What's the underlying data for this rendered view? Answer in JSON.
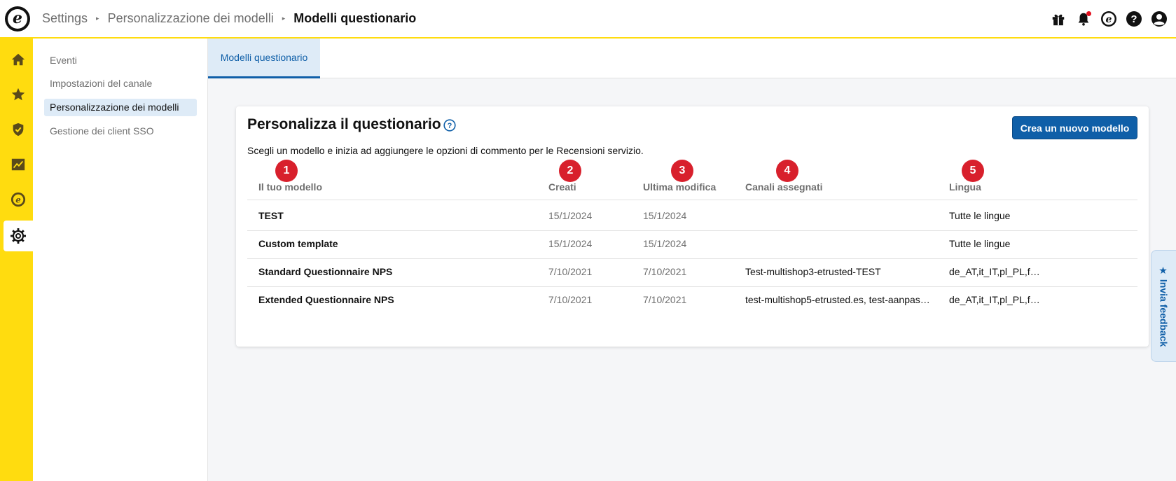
{
  "header": {
    "logo_letter": "e",
    "breadcrumb": [
      "Settings",
      "Personalizzazione dei modelli",
      "Modelli questionario"
    ],
    "icons": [
      "gift-icon",
      "bell-icon",
      "etrusted-icon",
      "help-icon",
      "account-icon"
    ]
  },
  "rail": {
    "items": [
      "home-icon",
      "star-icon",
      "shield-icon",
      "chart-icon",
      "etrusted-icon",
      "gear-icon"
    ],
    "active": "gear-icon"
  },
  "subnav": {
    "items": [
      {
        "label": "Eventi"
      },
      {
        "label": "Impostazioni del canale"
      },
      {
        "label": "Personalizzazione dei modelli"
      },
      {
        "label": "Gestione dei client SSO"
      }
    ],
    "active_index": 2
  },
  "tabs": [
    {
      "label": "Modelli questionario"
    }
  ],
  "card": {
    "title": "Personalizza il questionario",
    "description": "Scegli un modello e inizia ad aggiungere le opzioni di commento per le Recensioni servizio.",
    "create_button": "Crea un nuovo modello",
    "badges": [
      "1",
      "2",
      "3",
      "4",
      "5"
    ],
    "columns": [
      "Il tuo modello",
      "Creati",
      "Ultima modifica",
      "Canali assegnati",
      "Lingua"
    ],
    "rows": [
      {
        "name": "TEST",
        "created": "15/1/2024",
        "modified": "15/1/2024",
        "channels": "",
        "language": "Tutte le lingue"
      },
      {
        "name": "Custom template",
        "created": "15/1/2024",
        "modified": "15/1/2024",
        "channels": "",
        "language": "Tutte le lingue"
      },
      {
        "name": "Standard Questionnaire NPS",
        "created": "7/10/2021",
        "modified": "7/10/2021",
        "channels": "Test-multishop3-etrusted-TEST",
        "language": "de_AT,it_IT,pl_PL,f…"
      },
      {
        "name": "Extended Questionnaire NPS",
        "created": "7/10/2021",
        "modified": "7/10/2021",
        "channels": "test-multishop5-etrusted.es, test-aanpas…",
        "language": "de_AT,it_IT,pl_PL,f…"
      }
    ]
  },
  "feedback": {
    "label": "★ Invia feedback"
  },
  "colors": {
    "brand_yellow": "#ffdc0f",
    "primary_blue": "#0f5fa8",
    "badge_red": "#d8202c",
    "active_bg": "#deebf7"
  }
}
